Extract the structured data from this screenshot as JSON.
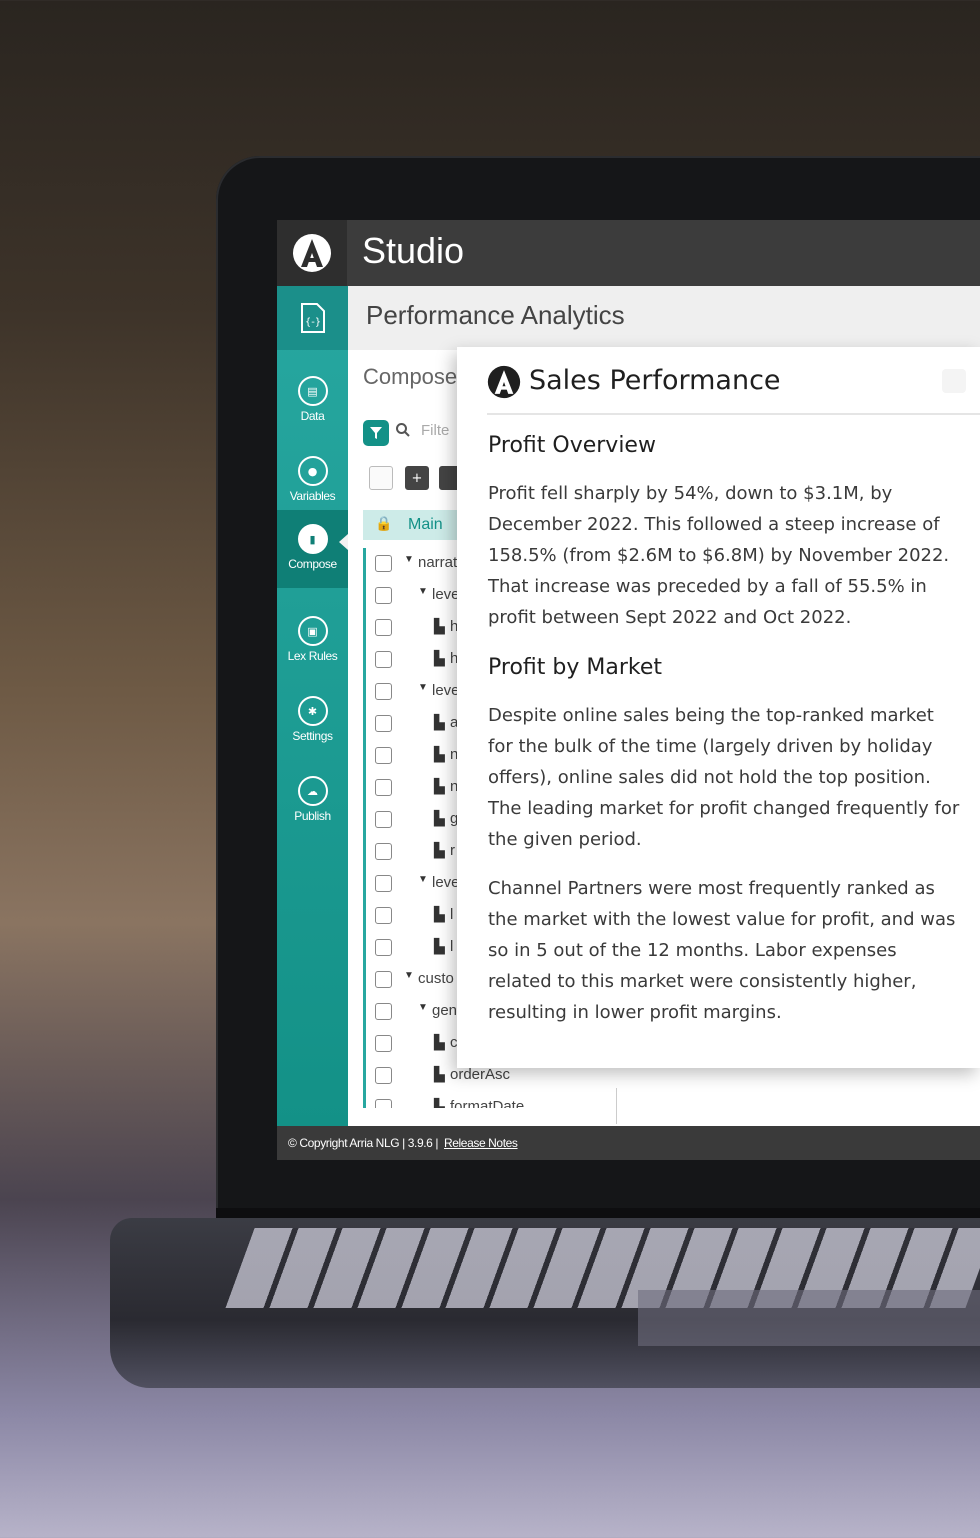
{
  "app": {
    "title": "Studio"
  },
  "sidebar": {
    "items": [
      {
        "label": "Data",
        "icon": "chart-icon"
      },
      {
        "label": "Variables",
        "icon": "pin-icon"
      },
      {
        "label": "Compose",
        "icon": "document-icon",
        "active": true
      },
      {
        "label": "Lex Rules",
        "icon": "rules-icon"
      },
      {
        "label": "Settings",
        "icon": "gear-icon"
      },
      {
        "label": "Publish",
        "icon": "cloud-upload-icon"
      }
    ]
  },
  "page": {
    "title": "Performance Analytics"
  },
  "compose": {
    "label": "Compose",
    "filter_placeholder": "Filte",
    "main_tab": "Main"
  },
  "tree": [
    {
      "name": "narrat",
      "type": "folder",
      "level": 0
    },
    {
      "name": "leve",
      "type": "folder",
      "level": 1
    },
    {
      "name": "h",
      "type": "file",
      "level": 2
    },
    {
      "name": "h",
      "type": "file",
      "level": 2
    },
    {
      "name": "leve",
      "type": "folder",
      "level": 1
    },
    {
      "name": "a",
      "type": "file",
      "level": 2
    },
    {
      "name": "n",
      "type": "file",
      "level": 2
    },
    {
      "name": "n",
      "type": "file",
      "level": 2
    },
    {
      "name": "g",
      "type": "file",
      "level": 2
    },
    {
      "name": "r",
      "type": "file",
      "level": 2
    },
    {
      "name": "leve",
      "type": "folder",
      "level": 1
    },
    {
      "name": "l",
      "type": "file",
      "level": 2
    },
    {
      "name": "l",
      "type": "file",
      "level": 2
    },
    {
      "name": "custo",
      "type": "folder",
      "level": 0
    },
    {
      "name": "gen",
      "type": "folder",
      "level": 1
    },
    {
      "name": "c",
      "type": "file",
      "level": 2
    },
    {
      "name": "orderAsc",
      "type": "file",
      "level": 2
    },
    {
      "name": "formatDate",
      "type": "file",
      "level": 2
    }
  ],
  "footer": {
    "copyright": "© Copyright Arria NLG | 3.9.6 |",
    "release_notes": "Release Notes"
  },
  "panel": {
    "title": "Sales Performance",
    "sections": [
      {
        "heading": "Profit Overview",
        "paragraphs": [
          "Profit fell sharply by 54%, down to $3.1M, by December 2022. This followed a steep increase of 158.5% (from $2.6M to $6.8M) by November 2022. That increase was preceded by a fall of 55.5% in profit between Sept 2022 and Oct 2022."
        ]
      },
      {
        "heading": "Profit by Market",
        "paragraphs": [
          "Despite online sales being the top-ranked market for the bulk of the time (largely driven by holiday offers), online sales did not hold the top position. The leading market for profit changed frequently for the given period.",
          "Channel Partners were most frequently ranked as the market with the lowest value for profit, and was so in 5 out of the 12 months. Labor expenses related to this market were consistently higher, resulting in lower profit margins."
        ]
      }
    ]
  },
  "colors": {
    "accent": "#139187",
    "sidebar_top": "#27a7a0",
    "topbar": "#3c3c3c"
  }
}
